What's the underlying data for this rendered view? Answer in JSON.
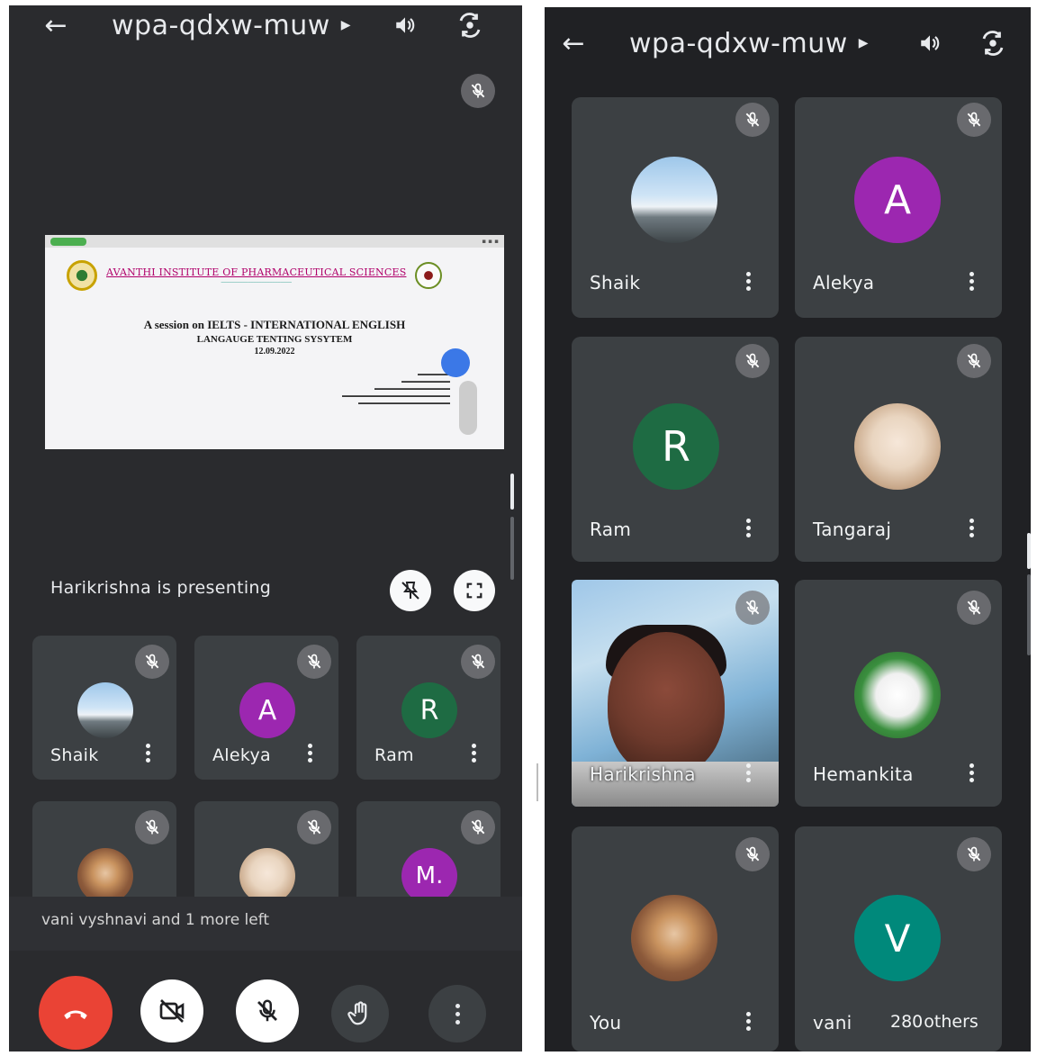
{
  "left": {
    "meeting_code": "wpa-qdxw-muw",
    "presentation": {
      "institute": "AVANTHI INSTITUTE OF PHARMACEUTICAL SCIENCES",
      "line1": "A session on  IELTS - INTERNATIONAL ENGLISH",
      "line2": "LANGAUGE TENTING SYSYTEM",
      "date": "12.09.2022"
    },
    "presenting_text": "Harikrishna is presenting",
    "participants": [
      {
        "name": "Shaik",
        "avatar": "photo-sky"
      },
      {
        "name": "Alekya",
        "initial": "A",
        "color": "#9c27b0"
      },
      {
        "name": "Ram",
        "initial": "R",
        "color": "#1e6b43"
      },
      {
        "name": "",
        "avatar": "photo-kid"
      },
      {
        "name": "",
        "avatar": "photo-girl"
      },
      {
        "name": "",
        "initial": "M.",
        "color": "#9c27b0"
      }
    ],
    "left_message": "vani vyshnavi and 1 more left"
  },
  "right": {
    "meeting_code": "wpa-qdxw-muw",
    "participants": [
      {
        "name": "Shaik",
        "avatar": "photo-sky"
      },
      {
        "name": "Alekya",
        "initial": "A",
        "color": "#9c27b0"
      },
      {
        "name": "Ram",
        "initial": "R",
        "color": "#1e6b43"
      },
      {
        "name": "Tangaraj",
        "avatar": "photo-girl"
      },
      {
        "name": "Harikrishna",
        "avatar": "video"
      },
      {
        "name": "Hemankita",
        "avatar": "photo-lady"
      },
      {
        "name": "You",
        "avatar": "photo-kid"
      },
      {
        "name": "vani",
        "initial": "V",
        "color": "#00897b"
      }
    ],
    "others_count": "280",
    "others_label": "others"
  },
  "colors": {
    "end_call": "#ea4335",
    "panel_bg": "#202124",
    "tile_bg": "#3c4043"
  },
  "icons": [
    "back-arrow-icon",
    "volume-icon",
    "switch-camera-icon",
    "mic-off-icon",
    "pin-off-icon",
    "fullscreen-icon",
    "end-call-icon",
    "camera-off-icon",
    "raise-hand-icon",
    "more-vert-icon"
  ]
}
